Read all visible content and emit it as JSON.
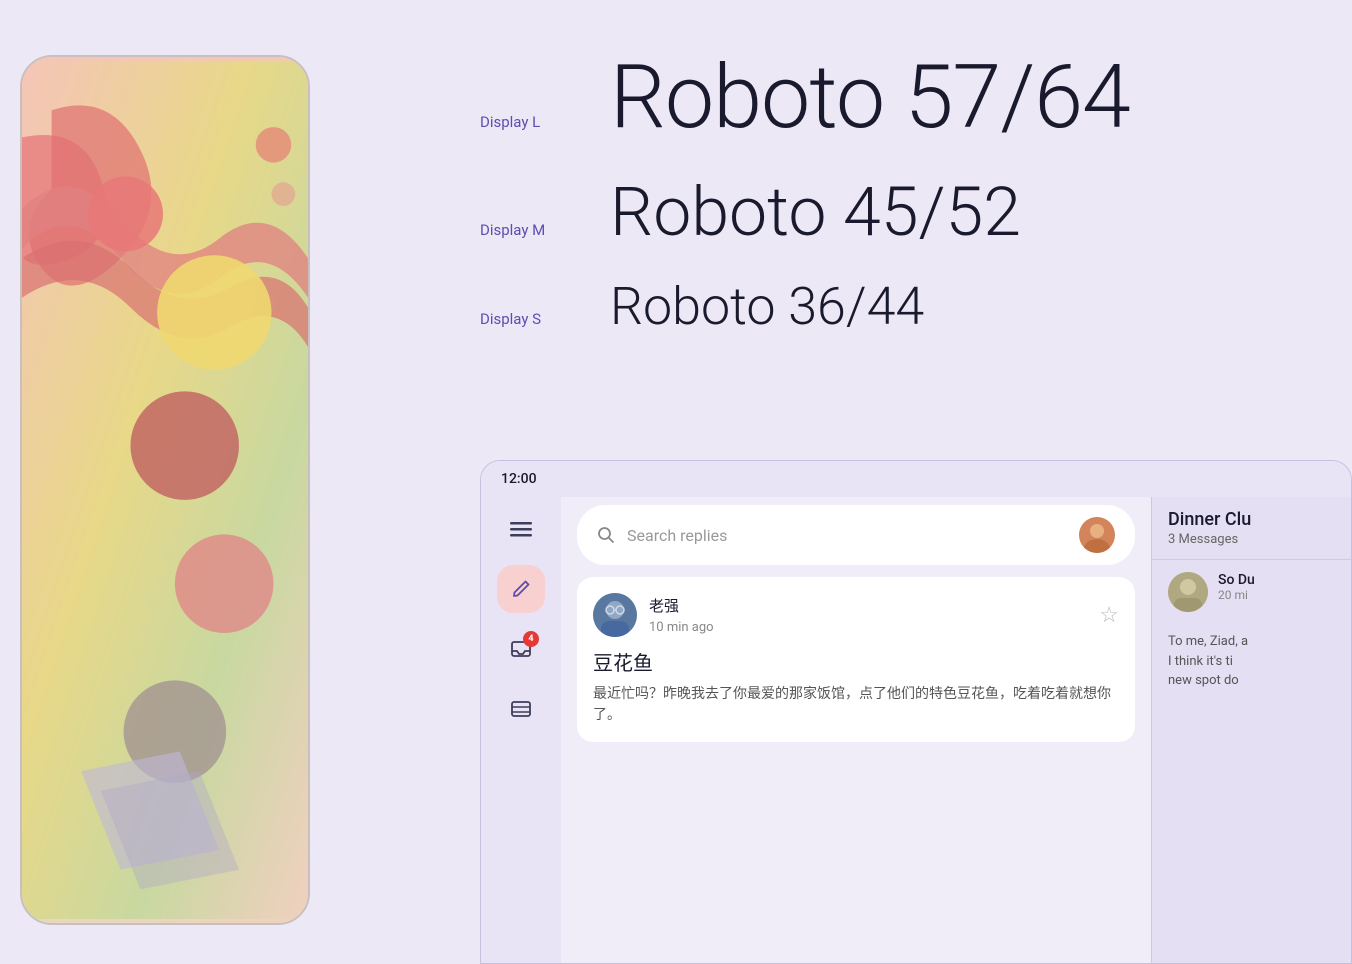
{
  "background_color": "#ede8f5",
  "phone_mockup": {
    "visible": true
  },
  "typography": {
    "display_l": {
      "label": "Display L",
      "text": "Roboto 57/64",
      "font_size": "88px"
    },
    "display_m": {
      "label": "Display M",
      "text": "Roboto 45/52",
      "font_size": "68px"
    },
    "display_s": {
      "label": "Display S",
      "text": "Roboto 36/44",
      "font_size": "52px"
    }
  },
  "phone_ui": {
    "status_time": "12:00",
    "search_placeholder": "Search replies",
    "message": {
      "sender": "老强",
      "time_ago": "10 min ago",
      "title": "豆花鱼",
      "preview": "最近忙吗？昨晚我去了你最爱的那家饭馆，点了他们的特色豆花鱼，吃着吃着就想你了。"
    },
    "right_panel": {
      "title": "Dinner Clu",
      "message_count": "3 Messages",
      "second_sender": "So Du",
      "second_time": "20 mi",
      "second_preview_line1": "To me, Ziad, a",
      "second_preview_line2": "I think it's ti",
      "second_preview_line3": "new spot do"
    },
    "sidebar": {
      "icons": [
        {
          "name": "menu",
          "symbol": "≡",
          "active": false
        },
        {
          "name": "compose",
          "symbol": "✏",
          "active": true
        },
        {
          "name": "inbox",
          "symbol": "📥",
          "active": false,
          "badge": 4
        },
        {
          "name": "list",
          "symbol": "☰",
          "active": false
        }
      ]
    }
  }
}
